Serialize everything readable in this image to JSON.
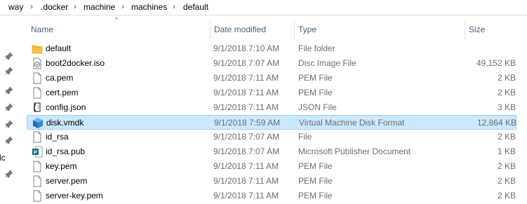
{
  "breadcrumb": {
    "items": [
      "way",
      ".docker",
      "machine",
      "machines",
      "default"
    ],
    "separator": "›"
  },
  "columns": {
    "name": "Name",
    "date": "Date modified",
    "type": "Type",
    "size": "Size"
  },
  "left_cut_text": "lс",
  "files": [
    {
      "name": "default",
      "date": "9/1/2018 7:10 AM",
      "type": "File folder",
      "size": "",
      "icon": "folder-icon"
    },
    {
      "name": "boot2docker.iso",
      "date": "9/1/2018 7:07 AM",
      "type": "Disc Image File",
      "size": "49,152 KB",
      "icon": "disc-image-icon"
    },
    {
      "name": "ca.pem",
      "date": "9/1/2018 7:11 AM",
      "type": "PEM File",
      "size": "2 KB",
      "icon": "document-icon"
    },
    {
      "name": "cert.pem",
      "date": "9/1/2018 7:11 AM",
      "type": "PEM File",
      "size": "2 KB",
      "icon": "document-icon"
    },
    {
      "name": "config.json",
      "date": "9/1/2018 7:11 AM",
      "type": "JSON File",
      "size": "3 KB",
      "icon": "json-file-icon"
    },
    {
      "name": "disk.vmdk",
      "date": "9/1/2018 7:59 AM",
      "type": "Virtual Machine Disk Format",
      "size": "12,864 KB",
      "icon": "vmdk-cube-icon",
      "selected": true
    },
    {
      "name": "id_rsa",
      "date": "9/1/2018 7:07 AM",
      "type": "File",
      "size": "2 KB",
      "icon": "document-icon"
    },
    {
      "name": "id_rsa.pub",
      "date": "9/1/2018 7:07 AM",
      "type": "Microsoft Publisher Document",
      "size": "1 KB",
      "icon": "publisher-icon"
    },
    {
      "name": "key.pem",
      "date": "9/1/2018 7:11 AM",
      "type": "PEM File",
      "size": "2 KB",
      "icon": "document-icon"
    },
    {
      "name": "server.pem",
      "date": "9/1/2018 7:11 AM",
      "type": "PEM File",
      "size": "2 KB",
      "icon": "document-icon"
    },
    {
      "name": "server-key.pem",
      "date": "9/1/2018 7:11 AM",
      "type": "PEM File",
      "size": "2 KB",
      "icon": "document-icon"
    }
  ],
  "colors": {
    "selection_bg": "#cce8ff",
    "selection_border": "#99d1ff",
    "header_text": "#4c607a",
    "folder": "#f5c242"
  }
}
